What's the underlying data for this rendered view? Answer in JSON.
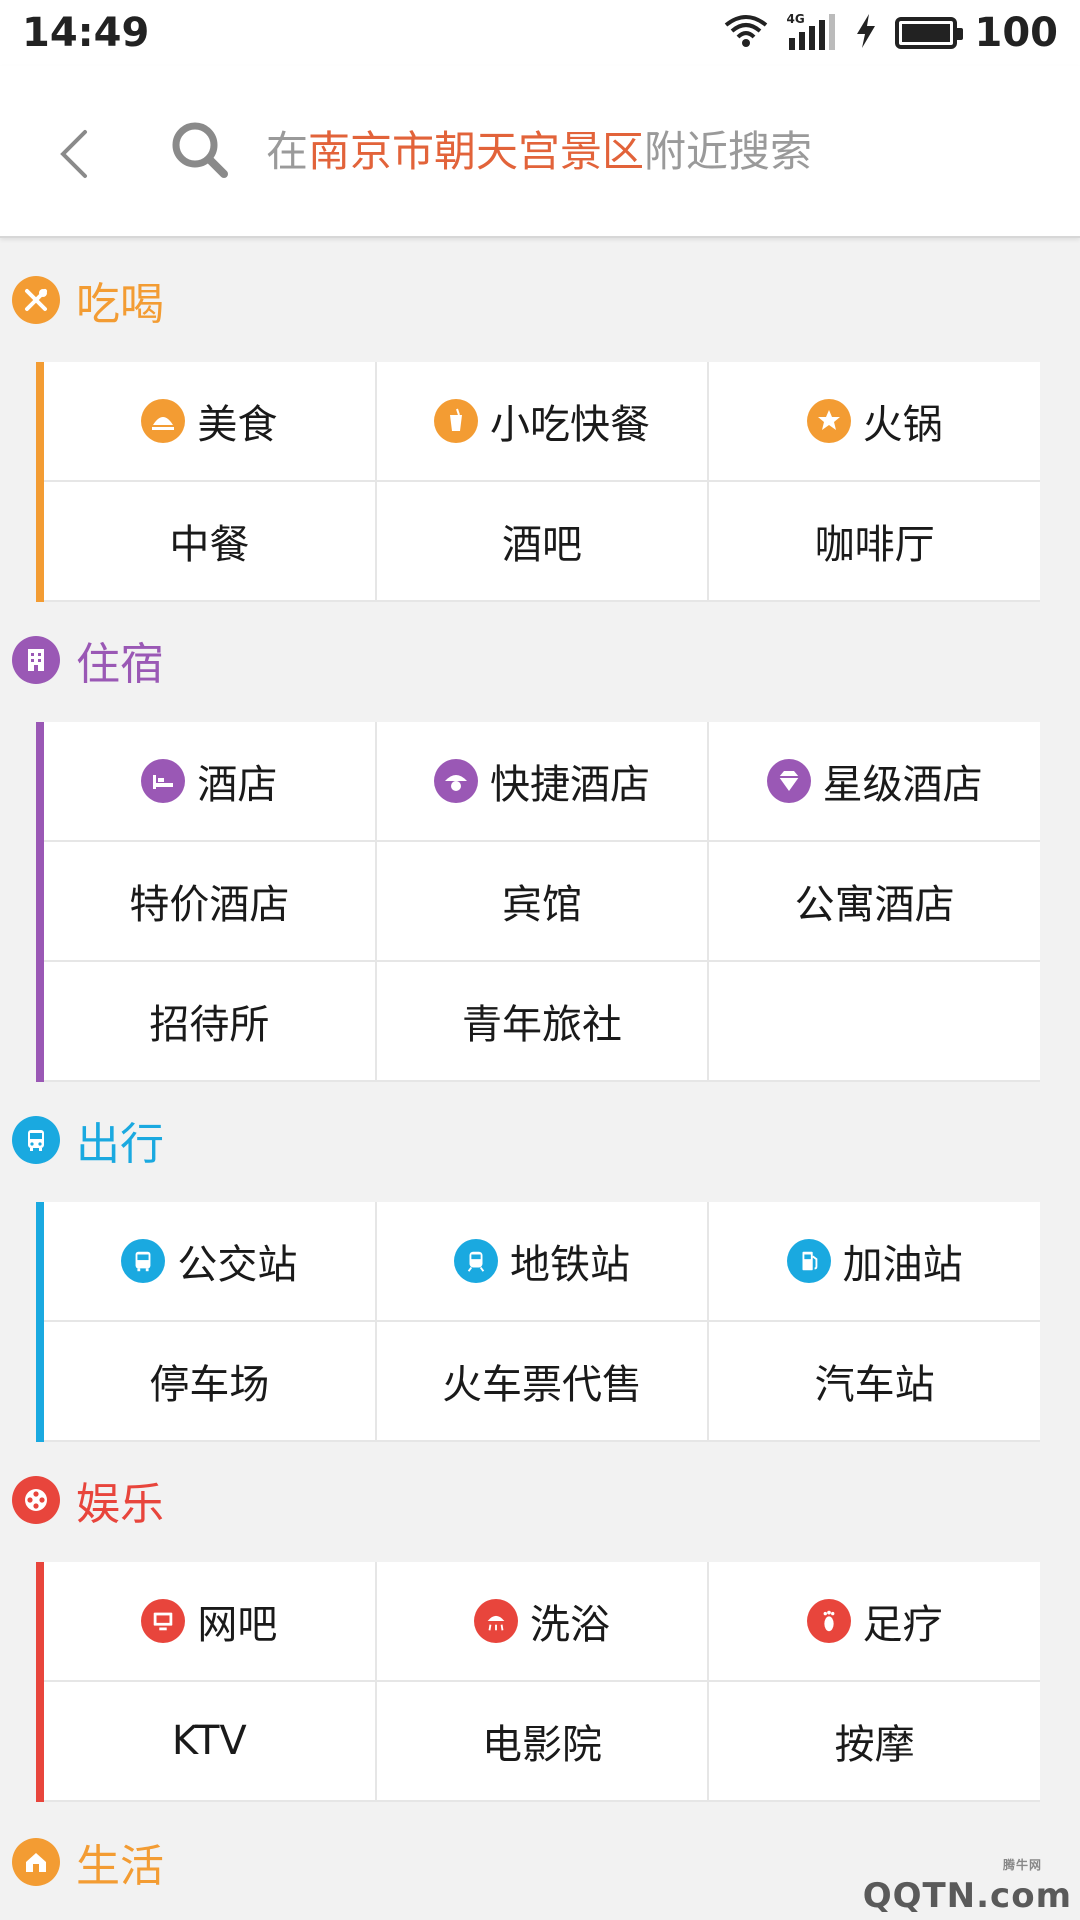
{
  "status_bar": {
    "time": "14:49",
    "network": "4G",
    "battery": "100"
  },
  "search": {
    "prefix": "在",
    "location": "南京市朝天宫景区",
    "suffix": "附近搜索"
  },
  "colors": {
    "eat": "#f39c33",
    "stay": "#9a58b5",
    "travel": "#1aa9e0",
    "fun": "#e8453c",
    "life": "#f39c33",
    "highlight": "#e2633a"
  },
  "sections": {
    "eat": {
      "title": "吃喝",
      "icon": "fork-knife-icon",
      "rows": [
        [
          "美食",
          "小吃快餐",
          "火锅"
        ],
        [
          "中餐",
          "酒吧",
          "咖啡厅"
        ]
      ]
    },
    "stay": {
      "title": "住宿",
      "icon": "building-icon",
      "rows": [
        [
          "酒店",
          "快捷酒店",
          "星级酒店"
        ],
        [
          "特价酒店",
          "宾馆",
          "公寓酒店"
        ],
        [
          "招待所",
          "青年旅社",
          ""
        ]
      ]
    },
    "travel": {
      "title": "出行",
      "icon": "bus-icon",
      "rows": [
        [
          "公交站",
          "地铁站",
          "加油站"
        ],
        [
          "停车场",
          "火车票代售",
          "汽车站"
        ]
      ]
    },
    "fun": {
      "title": "娱乐",
      "icon": "film-reel-icon",
      "rows": [
        [
          "网吧",
          "洗浴",
          "足疗"
        ],
        [
          "KTV",
          "电影院",
          "按摩"
        ]
      ]
    },
    "life": {
      "title": "生活",
      "icon": "house-icon"
    }
  },
  "watermark": {
    "text": "QQTN.com",
    "small": "腾牛网"
  }
}
